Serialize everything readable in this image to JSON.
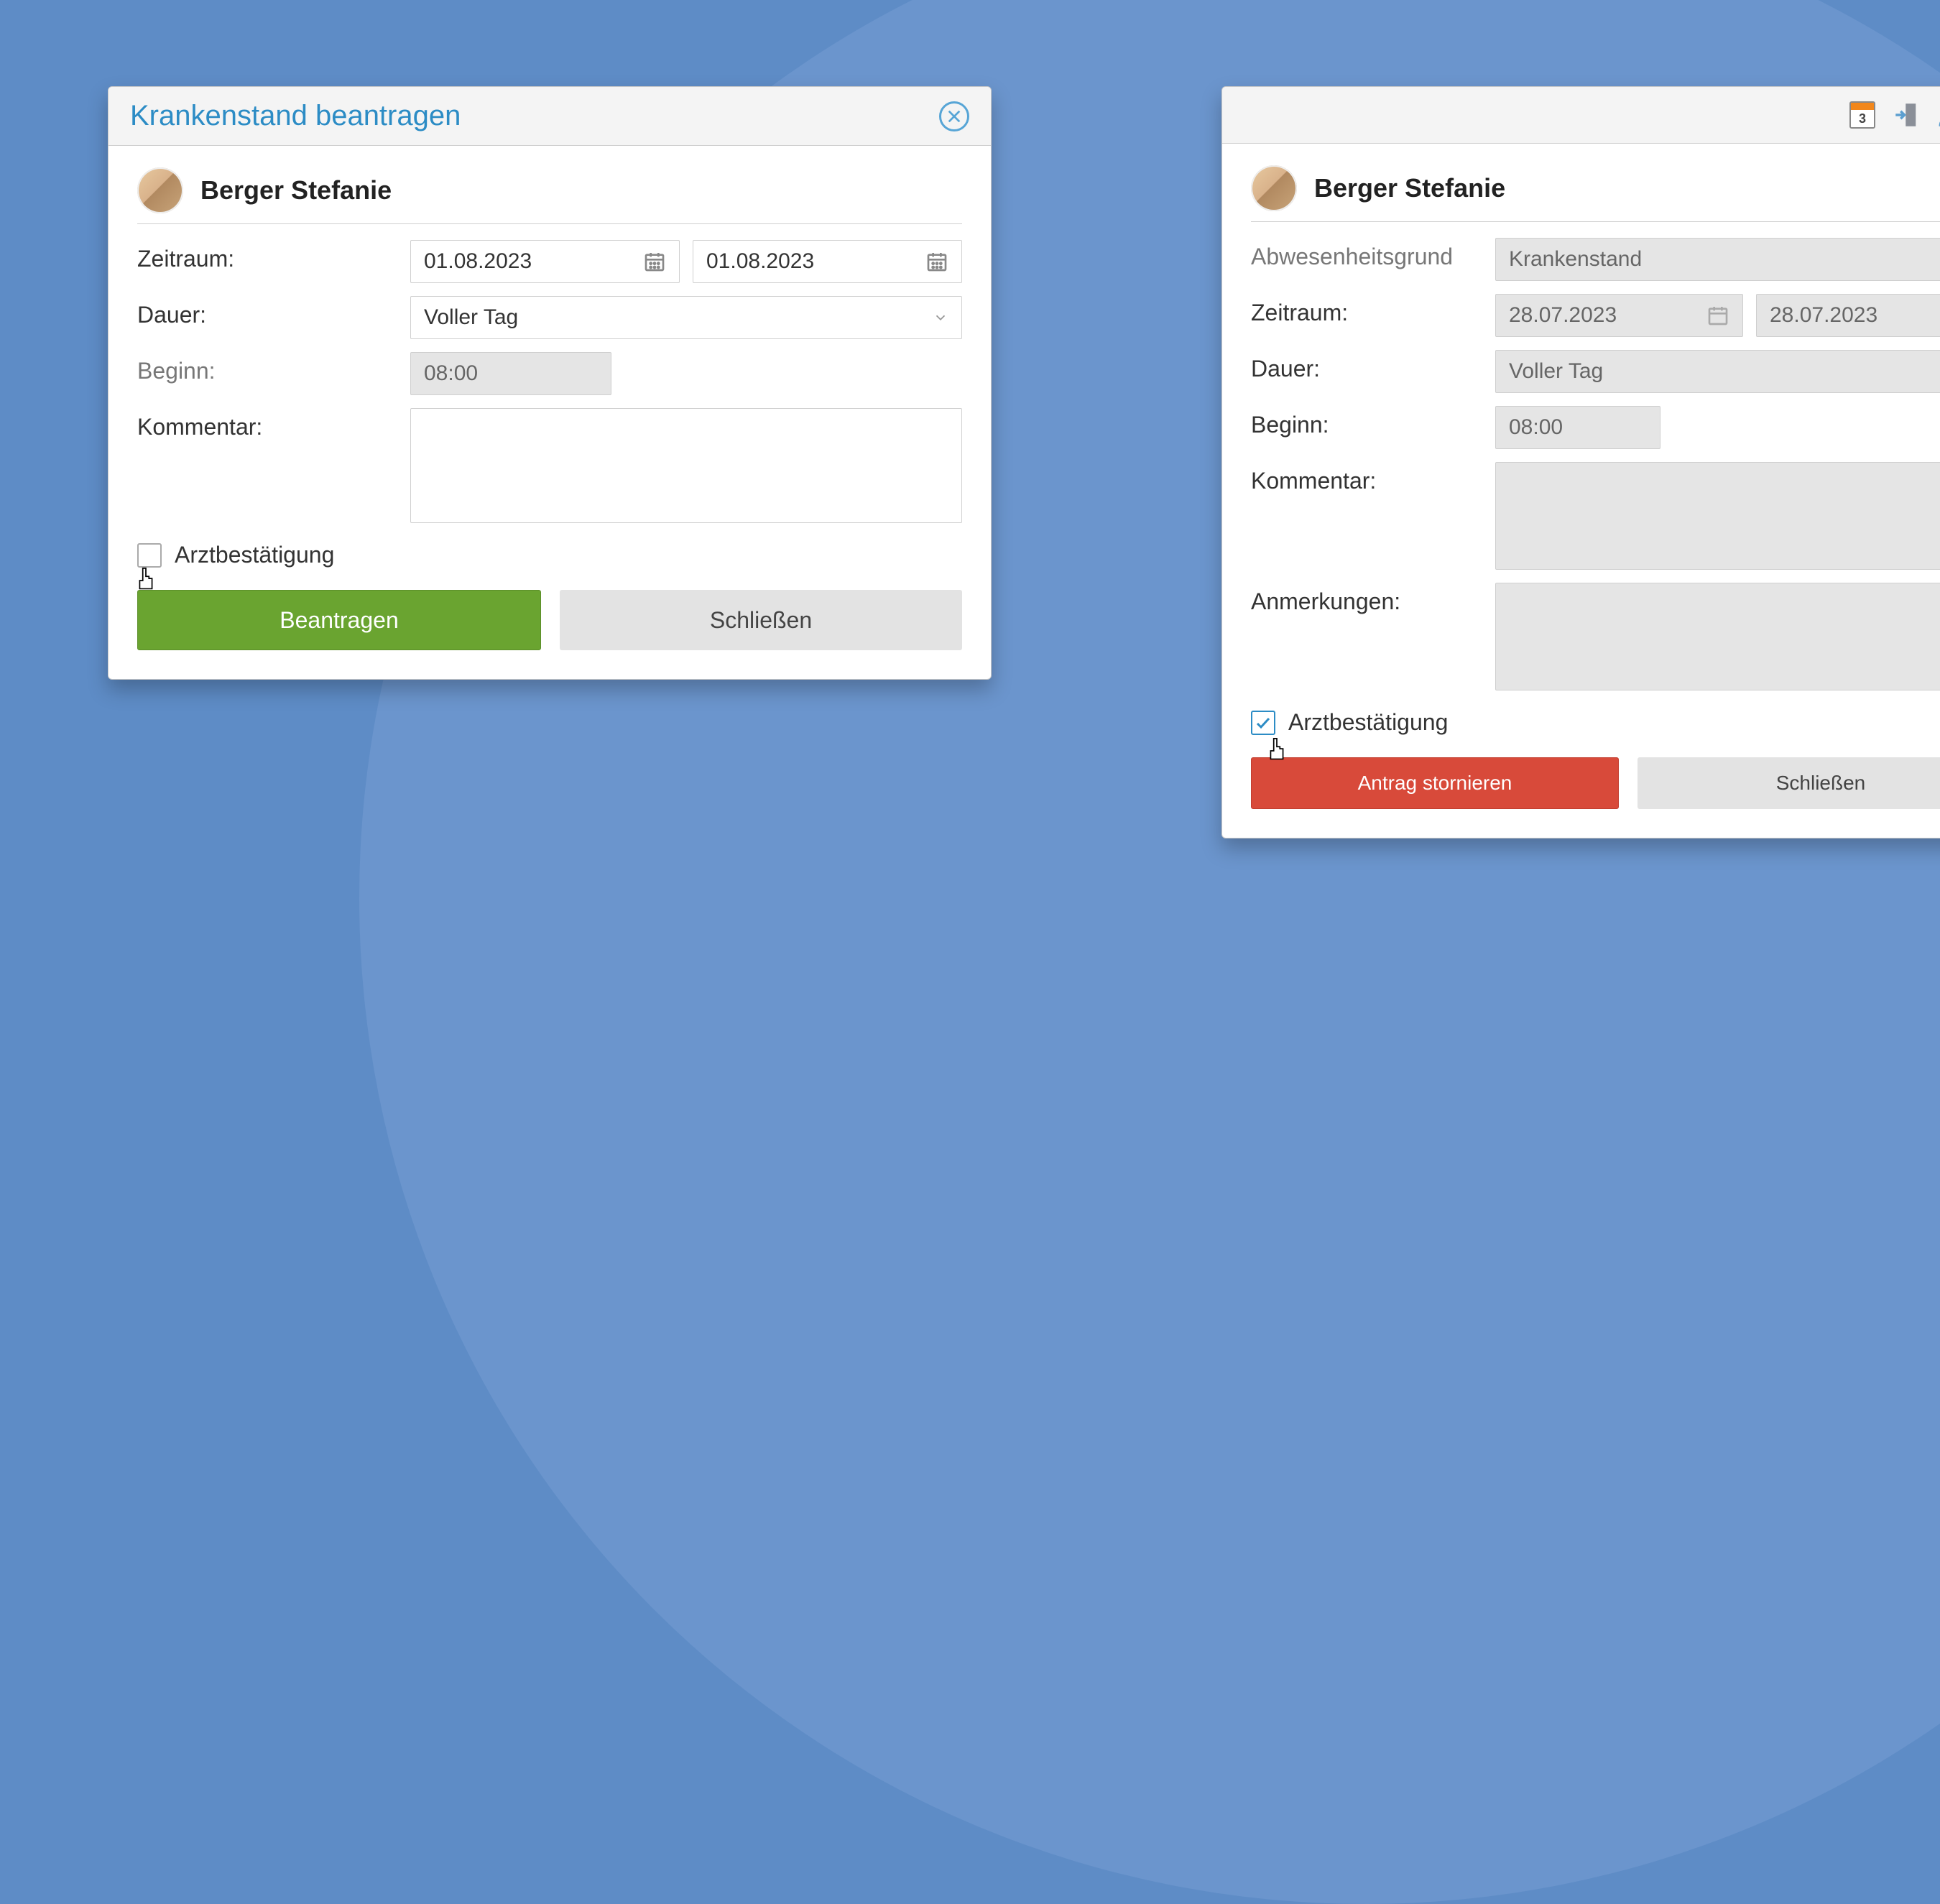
{
  "dialog1": {
    "title": "Krankenstand beantragen",
    "user_name": "Berger Stefanie",
    "labels": {
      "zeitraum": "Zeitraum:",
      "dauer": "Dauer:",
      "beginn": "Beginn:",
      "kommentar": "Kommentar:",
      "arztbestaetigung": "Arztbestätigung"
    },
    "fields": {
      "date_from": "01.08.2023",
      "date_to": "01.08.2023",
      "dauer_value": "Voller Tag",
      "beginn_value": "08:00",
      "kommentar_value": "",
      "arztbestaetigung_checked": false
    },
    "buttons": {
      "primary": "Beantragen",
      "secondary": "Schließen"
    }
  },
  "dialog2": {
    "header_calendar_num": "3",
    "user_name": "Berger Stefanie",
    "labels": {
      "grund": "Abwesenheitsgrund",
      "zeitraum": "Zeitraum:",
      "dauer": "Dauer:",
      "beginn": "Beginn:",
      "kommentar": "Kommentar:",
      "anmerkungen": "Anmerkungen:",
      "arztbestaetigung": "Arztbestätigung"
    },
    "fields": {
      "grund_value": "Krankenstand",
      "date_from": "28.07.2023",
      "date_to": "28.07.2023",
      "dauer_value": "Voller Tag",
      "beginn_value": "08:00",
      "kommentar_value": "",
      "anmerkungen_value": "",
      "arztbestaetigung_checked": true
    },
    "buttons": {
      "primary": "Antrag stornieren",
      "secondary": "Schließen"
    }
  },
  "colors": {
    "green": "#6aa430",
    "red": "#d84a3a",
    "accent_blue": "#2c8cc5",
    "orange": "#f2871b"
  }
}
